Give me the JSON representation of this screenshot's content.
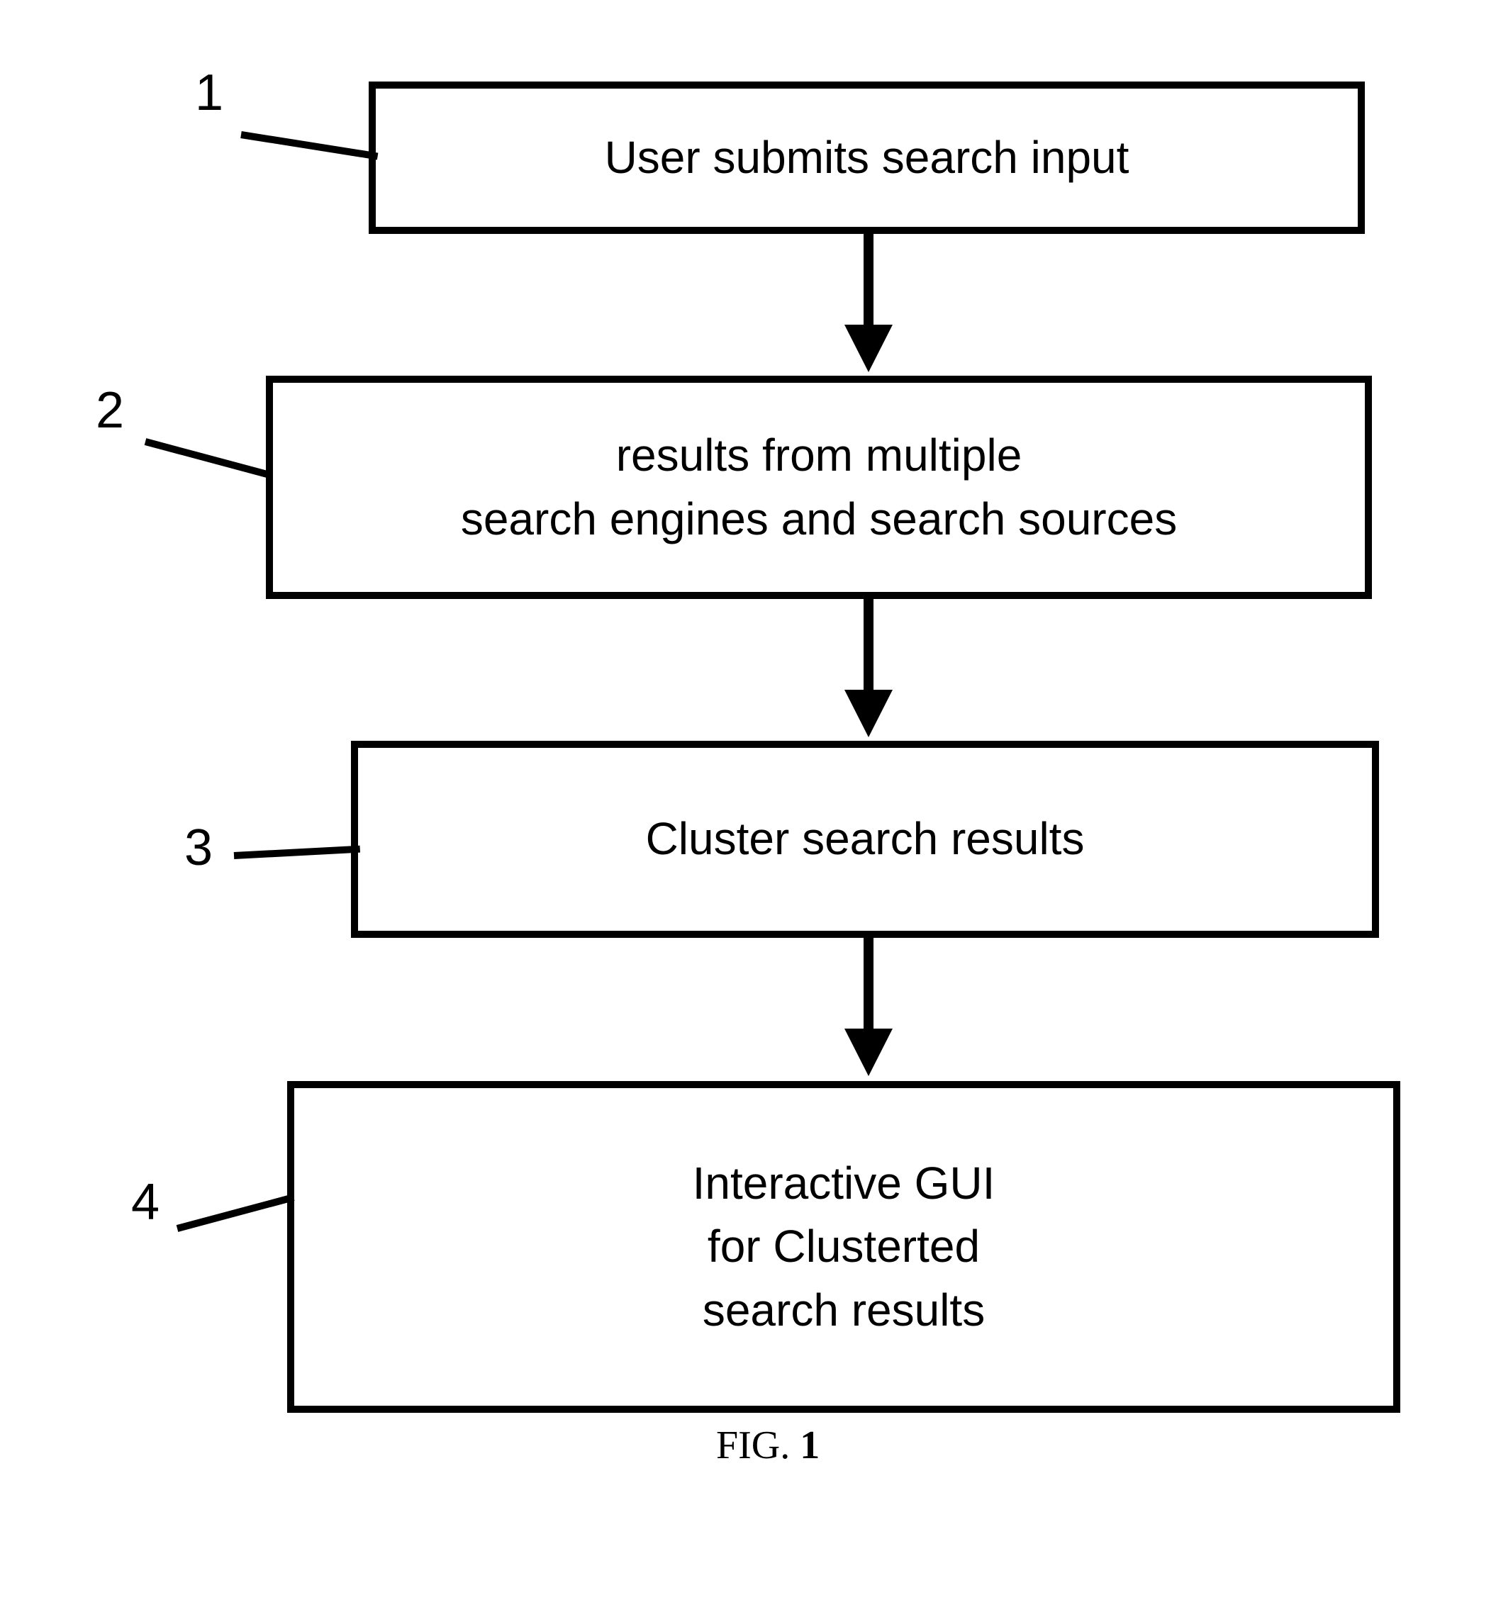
{
  "diagram": {
    "boxes": [
      {
        "num": "1",
        "text": "User submits search input"
      },
      {
        "num": "2",
        "text": "results from multiple\nsearch engines and search sources"
      },
      {
        "num": "3",
        "text": "Cluster search results"
      },
      {
        "num": "4",
        "text": "Interactive GUI\nfor Clusterted\nsearch results"
      }
    ],
    "caption_prefix": "FIG. ",
    "caption_num": "1"
  }
}
